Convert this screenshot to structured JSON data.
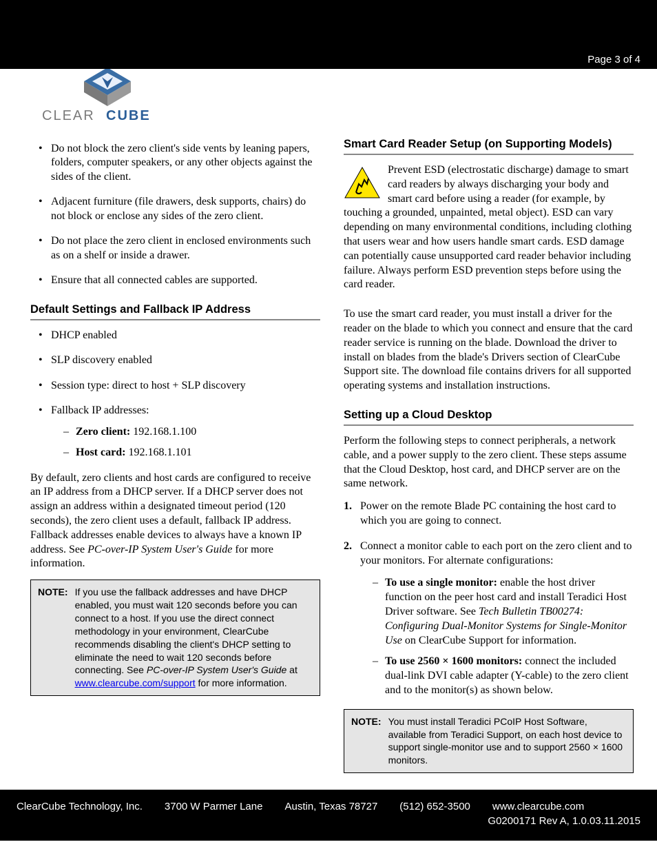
{
  "header": {
    "page_label": "Page 3 of 4"
  },
  "logo": {
    "brand_left": "CLEAR",
    "brand_right": "CUBE"
  },
  "left": {
    "top_bullets": [
      "Do not block the zero client's side vents by leaning papers, folders, computer speakers, or any other objects against the sides of the client.",
      "Adjacent furniture (file drawers, desk supports, chairs) do not block or enclose any sides of the zero client.",
      "Do not place the zero client in enclosed environments such as on a shelf or inside a drawer.",
      "Ensure that all connected cables are supported."
    ],
    "section1_title": "Default Settings and Fallback IP Address",
    "defaults_bullets": [
      "DHCP enabled",
      "SLP discovery enabled",
      "Session type: direct to host + SLP discovery"
    ],
    "fallback_label": "Fallback IP addresses:",
    "fallback_zero_label": "Zero client:",
    "fallback_zero_ip": " 192.168.1.100",
    "fallback_host_label": "Host card:",
    "fallback_host_ip": " 192.168.1.101",
    "para_pre": "By default, zero clients and host cards are configured to receive an IP address from a DHCP server. If a DHCP server does not assign an address within a designated timeout period (120 seconds), the zero client uses a default, fallback IP address. Fallback addresses enable devices to always have a known IP address. See ",
    "para_italic": "PC-over-IP System User's Guide",
    "para_post": " for more information.",
    "note_label": "NOTE:",
    "note_pre": "If you use the fallback addresses and have DHCP enabled, you must wait 120 seconds before you can connect to a host. If you use the direct connect methodology in your environment, ClearCube recommends disabling the client's DHCP setting to eliminate the need to wait 120 seconds before connecting. See ",
    "note_italic": "PC-over-IP System User's Guide",
    "note_mid": " at ",
    "note_link": "www.clearcube.com/support",
    "note_post": " for more information."
  },
  "right": {
    "section2_title": "Smart Card Reader Setup (on Supporting Models)",
    "esd_para": "Prevent ESD (electrostatic discharge) damage to smart card readers by always discharging your body and smart card before using a reader (for example, by touching a grounded, unpainted, metal object). ESD can vary depending on many environmental conditions, including clothing that users wear and how users handle smart cards. ESD damage can potentially cause unsupported card reader behavior including failure. Always perform ESD prevention steps before using the card reader.",
    "driver_para": "To use the smart card reader, you must install a driver for the reader on the blade to which you connect and ensure that the card reader service is running on the blade. Download the driver to install on blades from the blade's Drivers section of ClearCube Support site. The download file contains drivers for all supported operating systems and installation instructions.",
    "section3_title": "Setting up a Cloud Desktop",
    "cloud_intro": "Perform the following steps to connect peripherals, a network cable, and a power supply to the zero client. These steps assume that the Cloud Desktop, host card, and DHCP server are on the same network.",
    "step1": "Power on the remote Blade PC containing the host card to which you are going to connect.",
    "step2": "Connect a monitor cable to each port on the zero client and to your monitors. For alternate configurations:",
    "sub1_bold": "To use a single monitor:",
    "sub1_text": " enable the host driver function on the peer host card and install Teradici Host Driver software. See ",
    "sub1_italic": "Tech Bulletin TB00274: Configuring Dual-Monitor Systems for Single-Monitor Use",
    "sub1_post": " on ClearCube Support for information.",
    "sub2_bold": "To use 2560 × 1600 monitors:",
    "sub2_text": " connect the included dual-link DVI cable adapter (Y-cable) to the zero client and to the monitor(s) as shown below.",
    "note2_label": "NOTE:",
    "note2_text": "You must install Teradici PCoIP Host Software, available from Teradici Support, on each host device to support single-monitor use and to support 2560 × 1600 monitors."
  },
  "footer": {
    "company": "ClearCube Technology, Inc.",
    "addr1": "3700 W Parmer Lane",
    "addr2": "Austin, Texas 78727",
    "phone": "(512) 652-3500",
    "url": "www.clearcube.com",
    "rev": "G0200171 Rev A, 1.0.03.11.2015"
  }
}
